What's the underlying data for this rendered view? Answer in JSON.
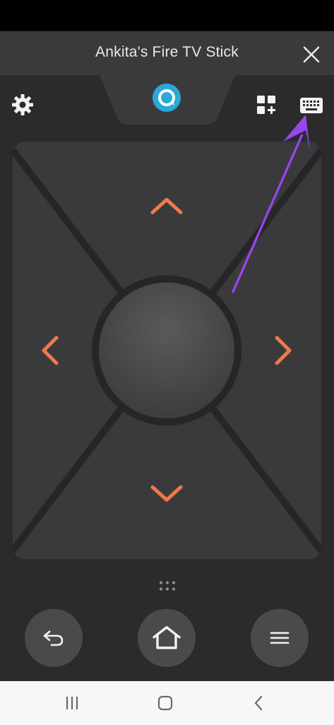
{
  "header": {
    "title": "Ankita's Fire TV Stick",
    "close_icon": "close-icon"
  },
  "toolbar": {
    "alexa_icon": "alexa-ring-icon",
    "settings_icon": "gear-icon",
    "apps_icon": "apps-grid-plus-icon",
    "keyboard_icon": "keyboard-icon"
  },
  "dpad": {
    "up_icon": "chevron-up-icon",
    "down_icon": "chevron-down-icon",
    "left_icon": "chevron-left-icon",
    "right_icon": "chevron-right-icon",
    "select_icon": "select-circle"
  },
  "controls": {
    "back_icon": "back-arrow-icon",
    "home_icon": "home-icon",
    "menu_icon": "hamburger-menu-icon",
    "handle_icon": "drag-dots-icon"
  },
  "system_nav": {
    "recents_icon": "recents-icon",
    "home_icon": "home-square-icon",
    "back_icon": "back-chevron-icon"
  },
  "colors": {
    "accent_orange": "#f0794a",
    "alexa_blue": "#2aa8d8",
    "annotation_purple": "#9b45f0",
    "background": "#2b2b2d",
    "panel": "#3a3a3c"
  }
}
